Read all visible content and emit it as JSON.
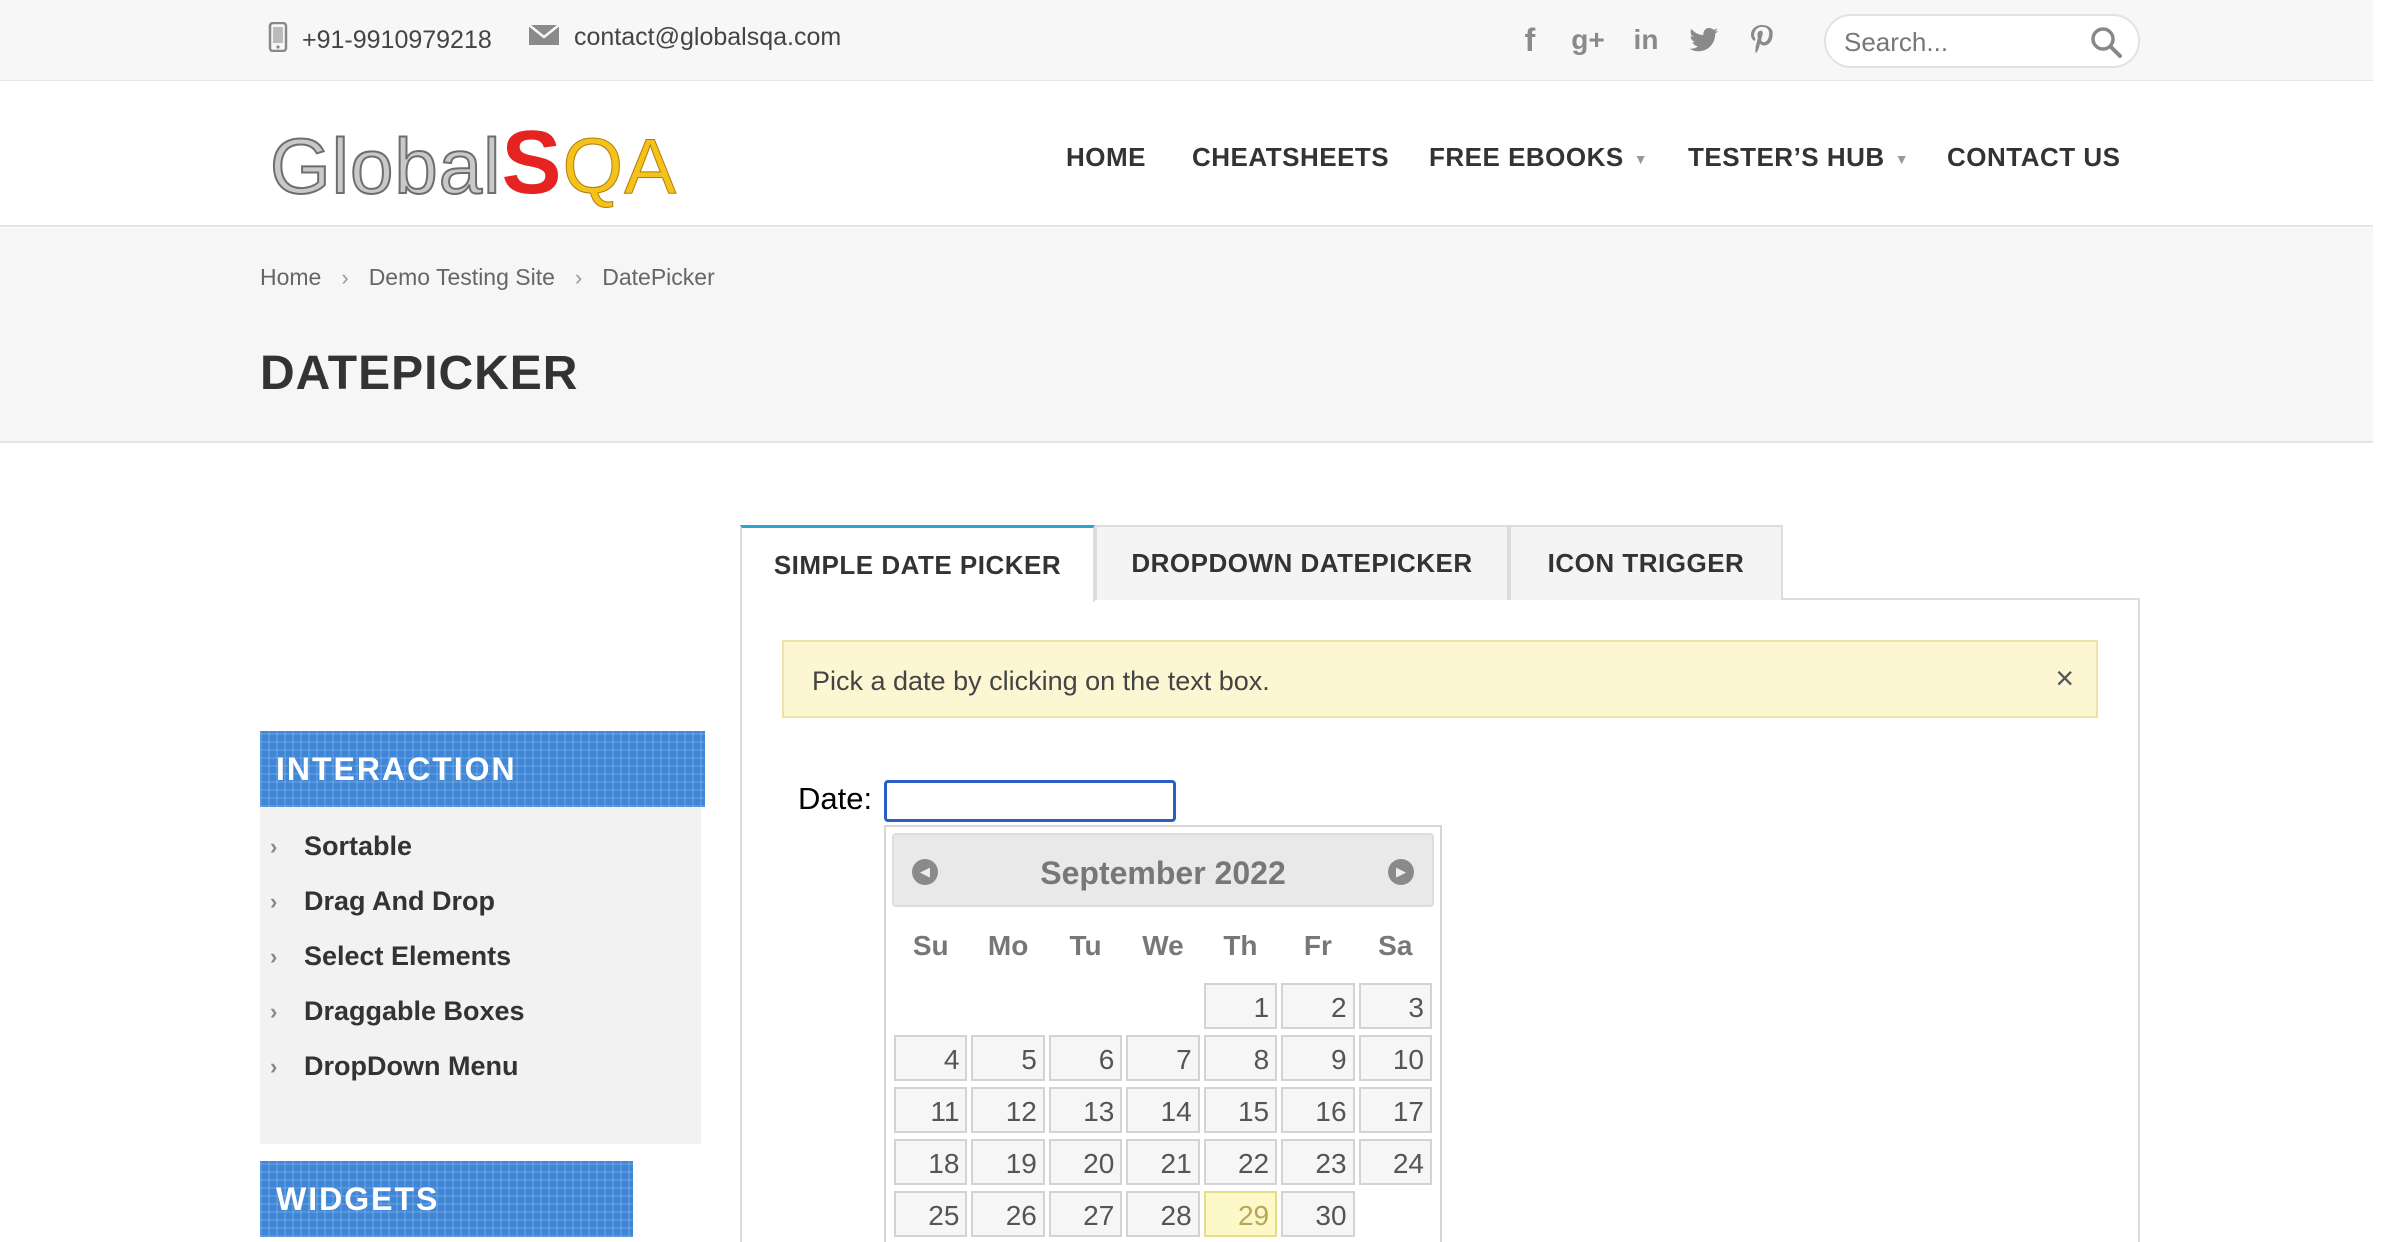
{
  "topbar": {
    "phone": "+91-9910979218",
    "email": "contact@globalsqa.com",
    "social": [
      {
        "icon": "facebook-icon",
        "glyph": "f"
      },
      {
        "icon": "google-plus-icon",
        "glyph": "g+"
      },
      {
        "icon": "linkedin-icon",
        "glyph": "in"
      },
      {
        "icon": "twitter-icon",
        "glyph": "t"
      },
      {
        "icon": "pinterest-icon",
        "glyph": "p"
      }
    ],
    "search_placeholder": "Search..."
  },
  "logo": {
    "part1": "Global",
    "part2": "S",
    "part3": "QA"
  },
  "nav": {
    "home": "HOME",
    "cheatsheets": "CHEATSHEETS",
    "free_ebooks": "FREE EBOOKS",
    "testers_hub": "TESTER’S HUB",
    "contact_us": "CONTACT US"
  },
  "breadcrumb": {
    "home": "Home",
    "demo": "Demo Testing Site",
    "current": "DatePicker"
  },
  "page_title": "DATEPICKER",
  "sidebar": {
    "interaction_title": "INTERACTION",
    "interaction_items": [
      "Sortable",
      "Drag And Drop",
      "Select Elements",
      "Draggable Boxes",
      "DropDown Menu"
    ],
    "widgets_title": "WIDGETS"
  },
  "tabs": {
    "simple": "SIMPLE DATE PICKER",
    "dropdown": "DROPDOWN DATEPICKER",
    "icon": "ICON TRIGGER"
  },
  "notice": {
    "text": "Pick a date by clicking on the text box.",
    "close": "×"
  },
  "date_label": "Date:",
  "datepicker": {
    "month_year": "September 2022",
    "prev": "◀",
    "next": "▶",
    "days_of_week": [
      "Su",
      "Mo",
      "Tu",
      "We",
      "Th",
      "Fr",
      "Sa"
    ],
    "leading_blanks": 4,
    "days": [
      "1",
      "2",
      "3",
      "4",
      "5",
      "6",
      "7",
      "8",
      "9",
      "10",
      "11",
      "12",
      "13",
      "14",
      "15",
      "16",
      "17",
      "18",
      "19",
      "20",
      "21",
      "22",
      "23",
      "24",
      "25",
      "26",
      "27",
      "28",
      "29",
      "30"
    ],
    "today": "29"
  },
  "colors": {
    "accent_blue": "#3f86d6",
    "tab_active": "#2aa5d3",
    "logo_red": "#e52320",
    "logo_yellow": "#f4c21a"
  }
}
